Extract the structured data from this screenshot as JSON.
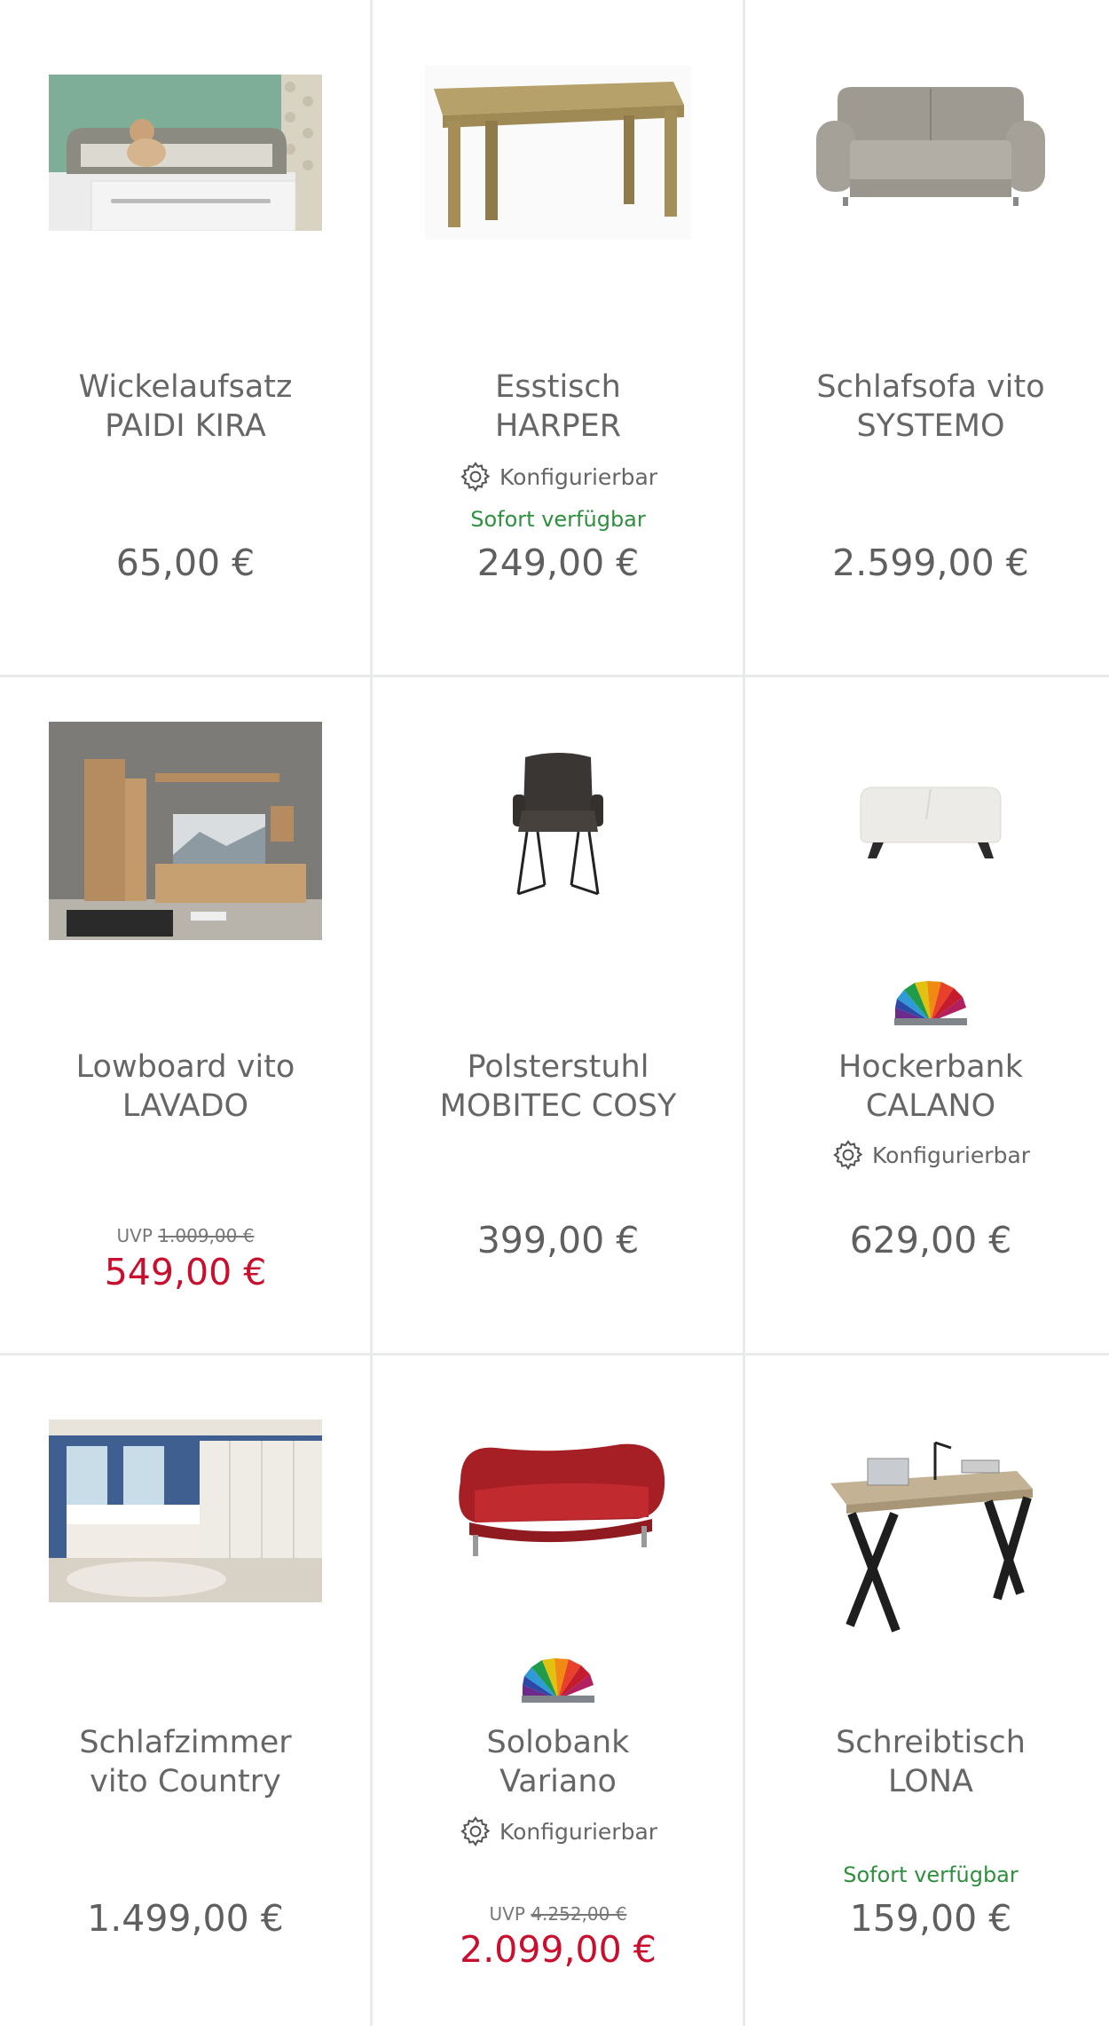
{
  "products": [
    {
      "name_l1": "Wickelaufsatz",
      "name_l2": "PAIDI KIRA",
      "price": "65,00 €",
      "image": "changing-table-top"
    },
    {
      "name_l1": "Esstisch",
      "name_l2": "HARPER",
      "configurable": "Konfigurierbar",
      "availability": "Sofort verfügbar",
      "price": "249,00 €",
      "image": "oak-dining-table"
    },
    {
      "name_l1": "Schlafsofa vito",
      "name_l2": "SYSTEMO",
      "price": "2.599,00 €",
      "image": "grey-sofa-bed"
    },
    {
      "name_l1": "Lowboard vito",
      "name_l2": "LAVADO",
      "uvp_label": "UVP",
      "uvp_price": "1.009,00 €",
      "price": "549,00 €",
      "sale": true,
      "image": "living-room-wall-unit"
    },
    {
      "name_l1": "Polsterstuhl",
      "name_l2": "MOBITEC COSY",
      "price": "399,00 €",
      "image": "dark-armchair"
    },
    {
      "name_l1": "Hockerbank",
      "name_l2": "CALANO",
      "configurable": "Konfigurierbar",
      "price": "629,00 €",
      "color_fan": true,
      "image": "white-ottoman-bench"
    },
    {
      "name_l1": "Schlafzimmer",
      "name_l2": "vito Country",
      "price": "1.499,00 €",
      "image": "country-bedroom"
    },
    {
      "name_l1": "Solobank",
      "name_l2": "Variano",
      "configurable": "Konfigurierbar",
      "uvp_label": "UVP",
      "uvp_price": "4.252,00 €",
      "price": "2.099,00 €",
      "sale": true,
      "color_fan": true,
      "image": "red-bench"
    },
    {
      "name_l1": "Schreibtisch",
      "name_l2": "LONA",
      "availability": "Sofort verfügbar",
      "price": "159,00 €",
      "image": "x-leg-desk"
    }
  ],
  "colors": {
    "sale": "#c8102e",
    "available": "#2f8f3f",
    "text": "#5f5f5f",
    "divider": "#e9eaeb"
  }
}
